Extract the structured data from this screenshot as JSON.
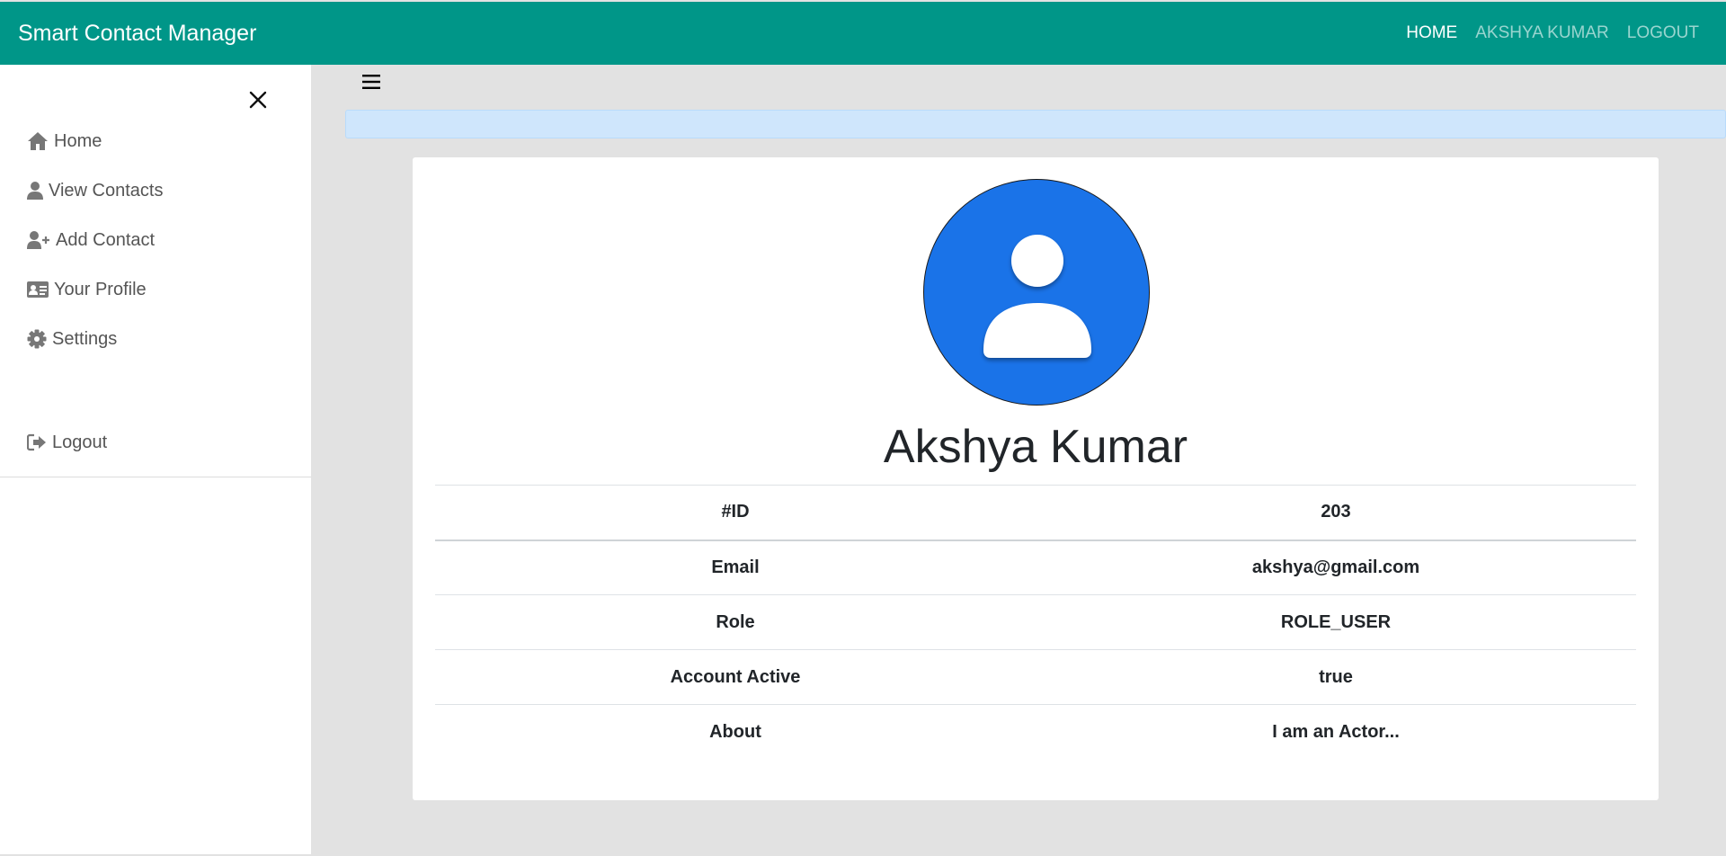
{
  "navbar": {
    "brand": "Smart Contact Manager",
    "links": [
      {
        "label": "HOME"
      },
      {
        "label": "AKSHYA KUMAR"
      },
      {
        "label": "LOGOUT"
      }
    ]
  },
  "sidebar": {
    "items": [
      {
        "label": "Home",
        "icon": "home-icon"
      },
      {
        "label": "View Contacts",
        "icon": "user-icon"
      },
      {
        "label": "Add Contact",
        "icon": "user-plus-icon"
      },
      {
        "label": "Your Profile",
        "icon": "id-card-icon"
      },
      {
        "label": "Settings",
        "icon": "gear-icon"
      },
      {
        "label": "Logout",
        "icon": "sign-out-icon"
      }
    ]
  },
  "colors": {
    "navbar": "#009688",
    "avatar": "#1a73e8",
    "alert": "#cfe6fc"
  },
  "profile": {
    "name": "Akshya Kumar",
    "rows": [
      {
        "label": "#ID",
        "value": "203"
      },
      {
        "label": "Email",
        "value": "akshya@gmail.com"
      },
      {
        "label": "Role",
        "value": "ROLE_USER"
      },
      {
        "label": "Account Active",
        "value": "true"
      },
      {
        "label": "About",
        "value": "I am an Actor..."
      }
    ]
  }
}
